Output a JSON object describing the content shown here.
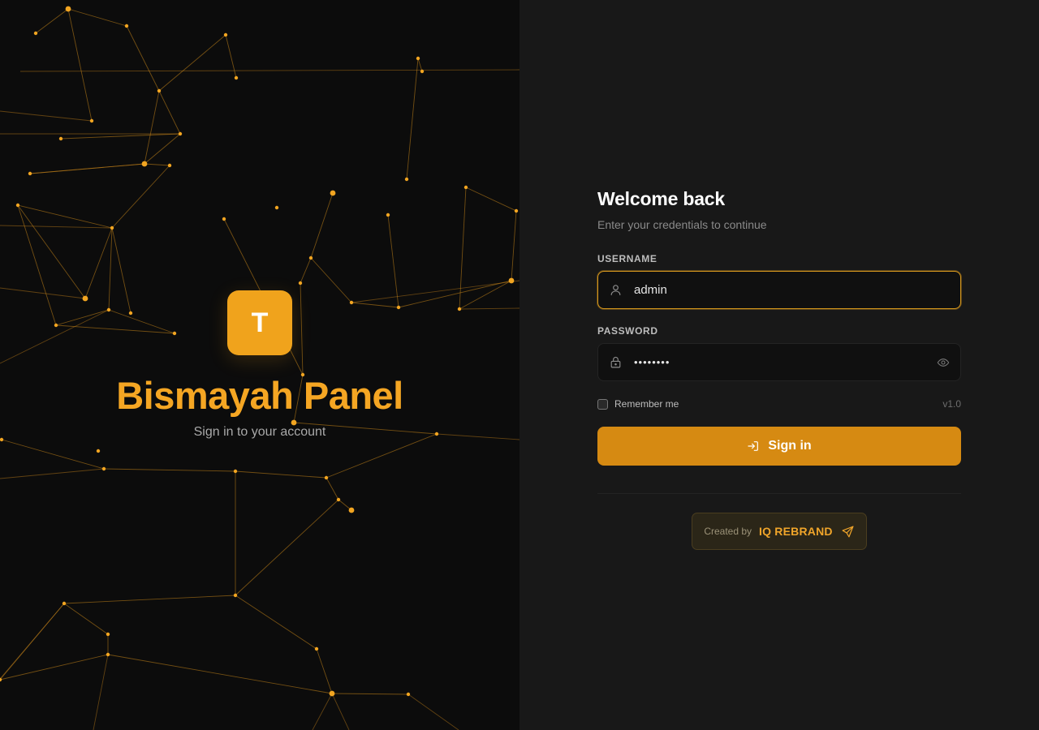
{
  "brand": {
    "logo_letter": "T",
    "title": "Bismayah Panel",
    "subtitle": "Sign in to your account"
  },
  "form": {
    "title": "Welcome back",
    "subtitle": "Enter your credentials to continue",
    "username": {
      "label": "USERNAME",
      "value": "admin",
      "icon": "user-icon"
    },
    "password": {
      "label": "PASSWORD",
      "value": "••••••••",
      "icon": "lock-icon",
      "toggle_icon": "eye-icon"
    },
    "remember_label": "Remember me",
    "remember_checked": false,
    "version": "v1.0",
    "submit_label": "Sign in",
    "submit_icon": "login-icon"
  },
  "credit": {
    "prefix": "Created by",
    "name": "IQ REBRAND",
    "icon": "send-icon"
  },
  "colors": {
    "accent": "#f5a623",
    "button": "#d68a12",
    "left_background": "#0c0c0c",
    "right_background": "#181818"
  }
}
